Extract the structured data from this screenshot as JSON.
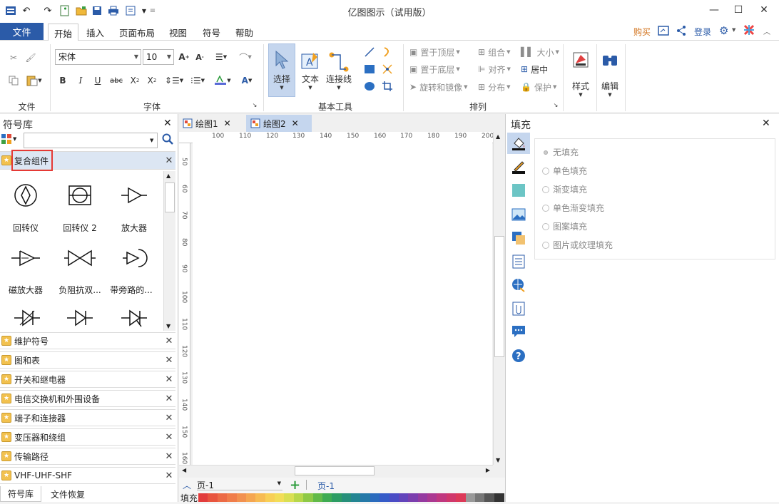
{
  "window": {
    "title": "亿图图示（试用版）"
  },
  "menu": {
    "file": "文件",
    "tabs": [
      "开始",
      "插入",
      "页面布局",
      "视图",
      "符号",
      "帮助"
    ],
    "right": {
      "buy": "购买",
      "login": "登录"
    }
  },
  "ribbon": {
    "groups": {
      "file": "文件",
      "font": "字体",
      "basic_tools": "基本工具",
      "arrange": "排列"
    },
    "font_name": "宋体",
    "font_size": "10",
    "tools": {
      "select": "选择",
      "text": "文本",
      "connector": "连接线"
    },
    "arrange": {
      "bring_front": "置于顶层",
      "send_back": "置于底层",
      "rotate_mirror": "旋转和镜像",
      "group": "组合",
      "align": "对齐",
      "distribute": "分布",
      "size": "大小",
      "center": "居中",
      "protect": "保护"
    },
    "style": "样式",
    "edit": "编辑"
  },
  "library": {
    "title": "符号库",
    "search_placeholder": "",
    "open_lib": "复合组件",
    "symbols": [
      "回转仪",
      "回转仪 2",
      "放大器",
      "磁放大器",
      "负阻抗双...",
      "带旁路的..."
    ],
    "libs": [
      "维护符号",
      "图和表",
      "开关和继电器",
      "电信交换机和外围设备",
      "端子和连接器",
      "变压器和绕组",
      "传输路径",
      "VHF-UHF-SHF"
    ],
    "bottom_tabs": [
      "符号库",
      "文件恢复"
    ]
  },
  "documents": {
    "tabs": [
      "绘图1",
      "绘图2"
    ],
    "active": "绘图2"
  },
  "ruler": {
    "h": [
      "100",
      "110",
      "120",
      "130",
      "140",
      "150",
      "160",
      "170",
      "180",
      "190",
      "200"
    ],
    "v": [
      "50",
      "60",
      "70",
      "80",
      "90",
      "100",
      "110",
      "120",
      "130",
      "140",
      "150",
      "160"
    ]
  },
  "pages": {
    "selector": "页-1",
    "active": "页-1"
  },
  "fill_label": "填充",
  "fill_panel": {
    "title": "填充",
    "options": [
      "无填充",
      "单色填充",
      "渐变填充",
      "单色渐变填充",
      "图案填充",
      "图片或纹理填充"
    ]
  },
  "palette": [
    "#e23c3c",
    "#e8543e",
    "#ec6a45",
    "#f07d4a",
    "#f2914f",
    "#f5a650",
    "#f7bb52",
    "#f8cf55",
    "#f2dd57",
    "#d9df52",
    "#b7d74a",
    "#8ec946",
    "#62ba48",
    "#3eab52",
    "#2c9c63",
    "#268f7a",
    "#238592",
    "#2579a8",
    "#2a6bbd",
    "#355bc8",
    "#4a4cc5",
    "#6244bb",
    "#7b3eae",
    "#953aa0",
    "#ab3891",
    "#c0377f",
    "#d0376b",
    "#dc3958",
    "#999999",
    "#777777",
    "#555555",
    "#333333"
  ]
}
